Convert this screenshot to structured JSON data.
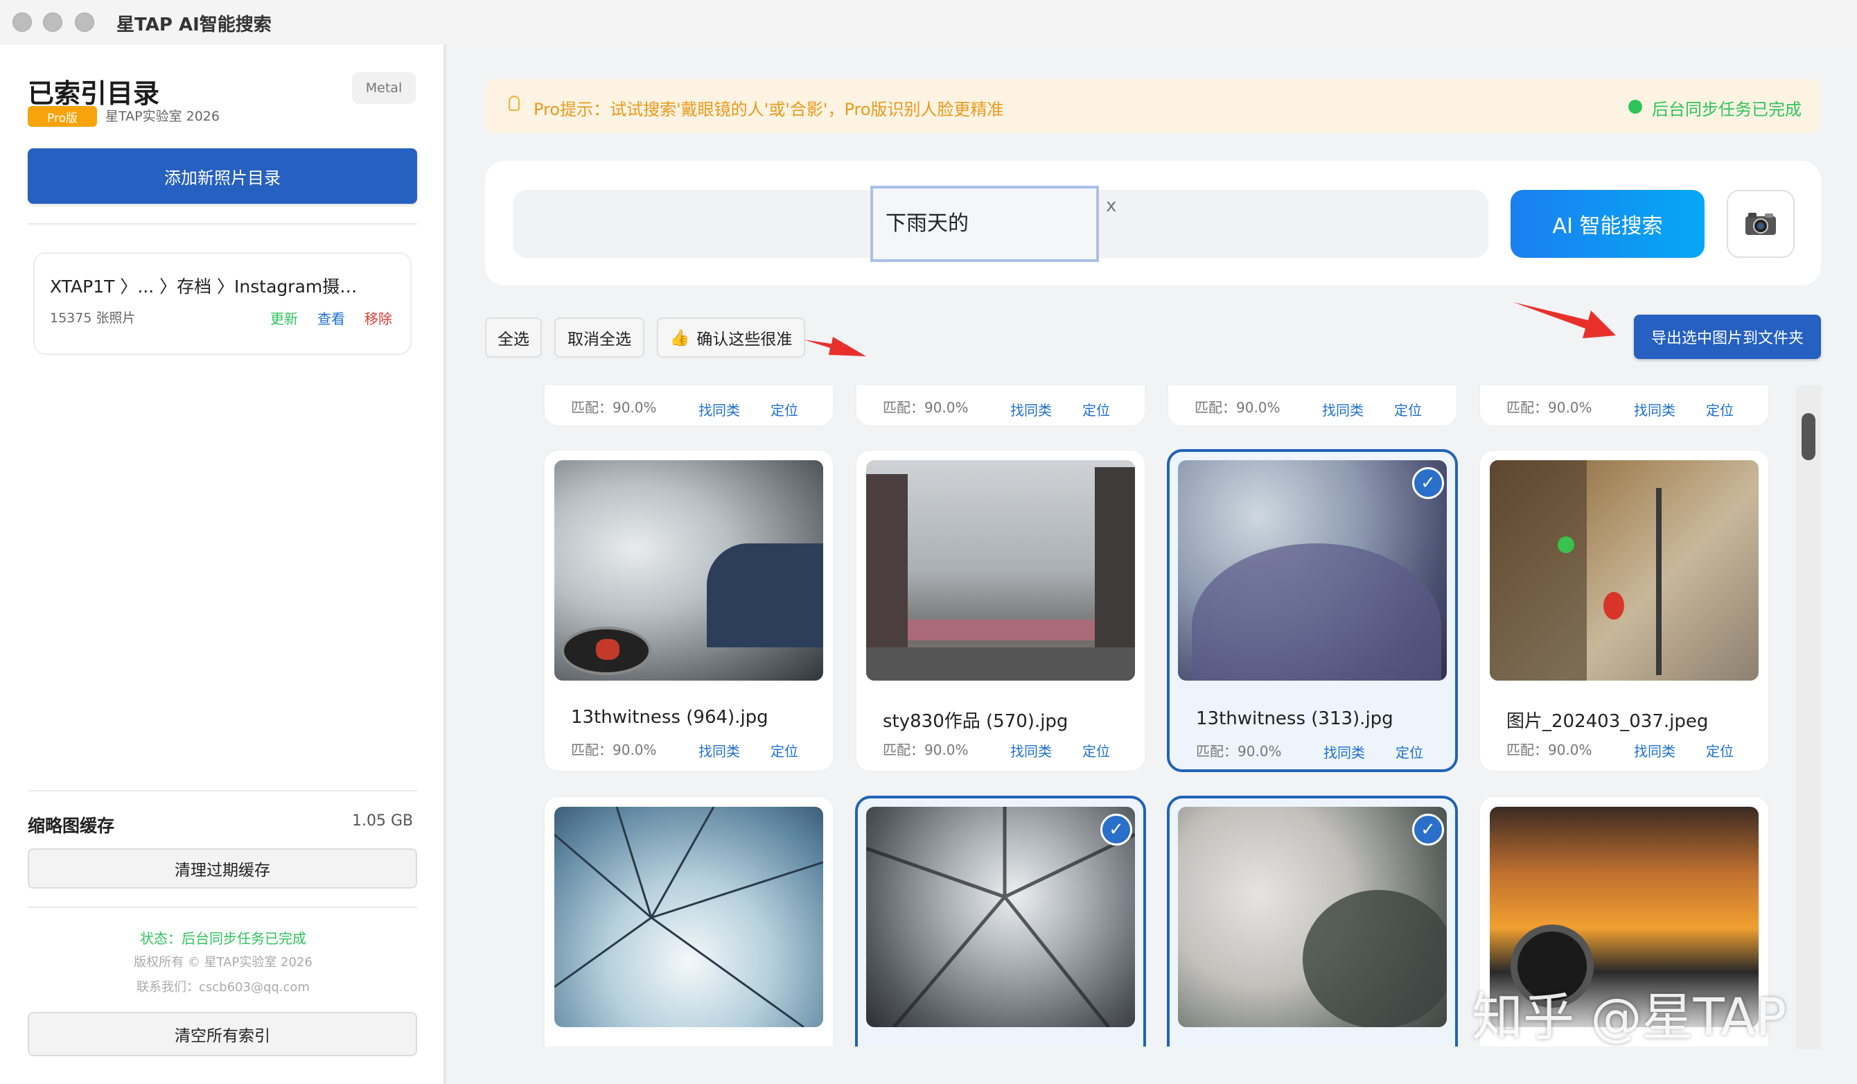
{
  "app": {
    "title": "星TAP AI智能搜索"
  },
  "sidebar": {
    "title": "已索引目录",
    "metal_badge": "Metal",
    "pro_badge": "Pro版",
    "studio": "星TAP实验室 2026",
    "add_button": "添加新照片目录",
    "directory": {
      "path": "XTAP1T 〉... 〉存档 〉Instagram摄…",
      "count": "15375 张照片",
      "update": "更新",
      "view": "查看",
      "remove": "移除"
    },
    "cache_label": "缩略图缓存",
    "cache_size": "1.05 GB",
    "clear_expired": "清理过期缓存",
    "status": "状态：后台同步任务已完成",
    "copyright": "版权所有 © 星TAP实验室 2026",
    "contact": "联系我们：cscb603@qq.com",
    "clear_all": "清空所有索引"
  },
  "tip": {
    "text": "Pro提示：试试搜索'戴眼镜的人'或'合影'，Pro版识别人脸更精准",
    "sync_status": "后台同步任务已完成"
  },
  "search": {
    "query": "下雨天的",
    "clear": "x",
    "ai_button": "AI 智能搜索"
  },
  "toolbar": {
    "select_all": "全选",
    "deselect_all": "取消全选",
    "confirm": "确认这些很准",
    "export": "导出选中图片到文件夹"
  },
  "results": {
    "match_label": "匹配：90.0%",
    "similar": "找同类",
    "locate": "定位",
    "row2": [
      {
        "name": "13thwitness (964).jpg",
        "selected": false
      },
      {
        "name": "sty830作品 (570).jpg",
        "selected": false
      },
      {
        "name": "13thwitness (313).jpg",
        "selected": true
      },
      {
        "name": "图片_202403_037.jpeg",
        "selected": false
      }
    ],
    "row3": [
      {
        "selected": false
      },
      {
        "selected": true
      },
      {
        "selected": true
      },
      {
        "selected": false
      }
    ]
  },
  "watermark": "知乎 @星TAP",
  "colors": {
    "primary": "#2660c0",
    "accent_blue": "#1c6fd0",
    "success": "#2ec45a",
    "warning": "#e89a1c",
    "danger": "#e0392f"
  }
}
